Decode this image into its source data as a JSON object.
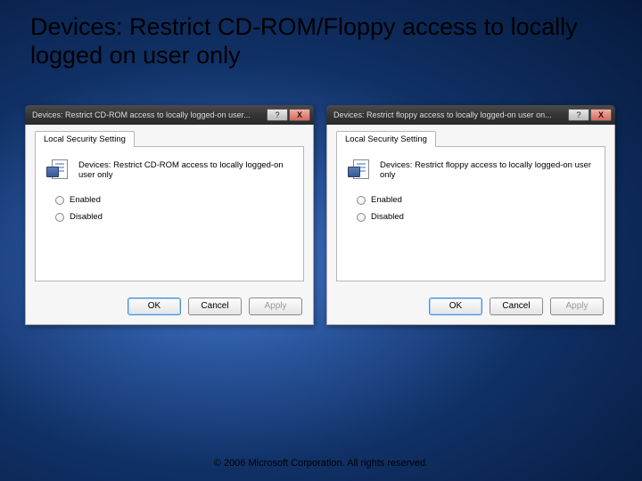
{
  "slide": {
    "title": "Devices: Restrict CD-ROM/Floppy access to locally logged on user only"
  },
  "dialog_left": {
    "title": "Devices: Restrict CD-ROM access to locally logged-on user...",
    "help_label": "?",
    "close_label": "X",
    "tab_label": "Local Security Setting",
    "policy_name": "Devices: Restrict CD-ROM access to locally logged-on user only",
    "option_enabled": "Enabled",
    "option_disabled": "Disabled",
    "ok_label": "OK",
    "cancel_label": "Cancel",
    "apply_label": "Apply"
  },
  "dialog_right": {
    "title": "Devices: Restrict floppy access to locally logged-on user on...",
    "help_label": "?",
    "close_label": "X",
    "tab_label": "Local Security Setting",
    "policy_name": "Devices: Restrict floppy access to locally logged-on user only",
    "option_enabled": "Enabled",
    "option_disabled": "Disabled",
    "ok_label": "OK",
    "cancel_label": "Cancel",
    "apply_label": "Apply"
  },
  "footer": {
    "copyright": "© 2006 Microsoft Corporation. All rights reserved."
  }
}
